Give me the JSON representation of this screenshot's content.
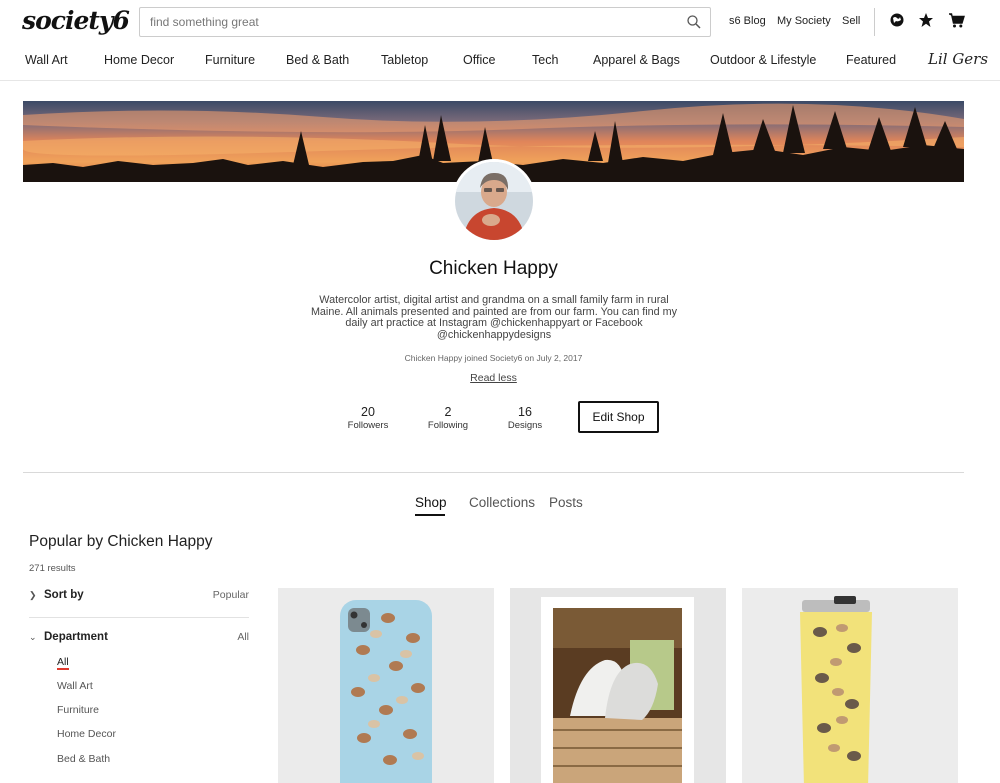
{
  "header": {
    "logo": "society6",
    "search_placeholder": "find something great",
    "links": [
      "s6 Blog",
      "My Society",
      "Sell"
    ],
    "icons": [
      "search-icon",
      "world-icon",
      "star-icon",
      "cart-icon"
    ]
  },
  "nav": {
    "items": [
      "Wall Art",
      "Home Decor",
      "Furniture",
      "Bed & Bath",
      "Tabletop",
      "Office",
      "Tech",
      "Apparel & Bags",
      "Outdoor & Lifestyle",
      "Featured"
    ],
    "script_item": "Lil Gers"
  },
  "profile": {
    "name": "Chicken Happy",
    "bio": "Watercolor artist, digital artist and grandma on a small family farm in rural Maine. All animals presented and painted are from our farm. You can find my daily art practice at Instagram @chickenhappyart or Facebook @chickenhappydesigns",
    "joined": "Chicken Happy joined Society6 on July 2, 2017",
    "read_less": "Read less",
    "stats": [
      {
        "num": "20",
        "label": "Followers"
      },
      {
        "num": "2",
        "label": "Following"
      },
      {
        "num": "16",
        "label": "Designs"
      }
    ],
    "edit_button": "Edit Shop"
  },
  "tabs": [
    "Shop",
    "Collections",
    "Posts"
  ],
  "shop": {
    "title": "Popular by Chicken Happy",
    "results": "271 results",
    "sort_label": "Sort by",
    "sort_value": "Popular",
    "department_label": "Department",
    "department_value": "All",
    "departments": [
      "All",
      "Wall Art",
      "Furniture",
      "Home Decor",
      "Bed & Bath"
    ]
  },
  "colors": {
    "accent_underline": "#e03a2e",
    "phone_case_bg": "#a9d4e6",
    "tumbler_bg": "#f2e27a"
  }
}
